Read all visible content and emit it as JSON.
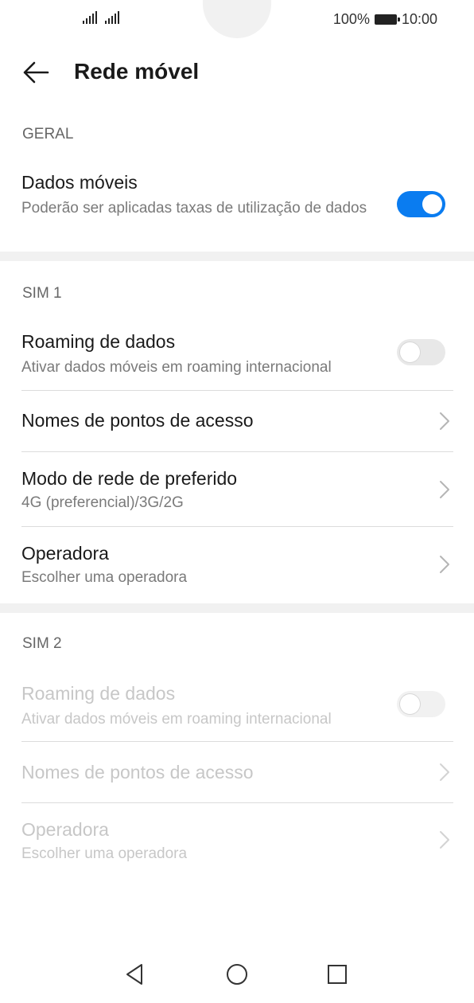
{
  "status_bar": {
    "battery_percent": "100%",
    "time": "10:00",
    "signal_icons": [
      "signal-sim1-icon",
      "signal-sim2-icon"
    ]
  },
  "header": {
    "title": "Rede móvel",
    "back_icon": "arrow-left-icon"
  },
  "general": {
    "label": "GERAL",
    "mobile_data": {
      "title": "Dados móveis",
      "subtitle": "Poderão ser aplicadas taxas de utilização de dados",
      "enabled": true
    }
  },
  "sim1": {
    "label": "SIM 1",
    "roaming": {
      "title": "Roaming de dados",
      "subtitle": "Ativar dados móveis em roaming internacional",
      "enabled": false
    },
    "apn": {
      "title": "Nomes de pontos de acesso"
    },
    "network_mode": {
      "title": "Modo de rede de preferido",
      "subtitle": "4G (preferencial)/3G/2G"
    },
    "operator": {
      "title": "Operadora",
      "subtitle": "Escolher uma operadora"
    }
  },
  "sim2": {
    "label": "SIM 2",
    "roaming": {
      "title": "Roaming de dados",
      "subtitle": "Ativar dados móveis em roaming internacional",
      "enabled": false
    },
    "apn": {
      "title": "Nomes de pontos de acesso"
    },
    "operator": {
      "title": "Operadora",
      "subtitle": "Escolher uma operadora"
    }
  },
  "nav": {
    "back": "triangle-back-icon",
    "home": "circle-home-icon",
    "recents": "square-recents-icon"
  },
  "colors": {
    "accent": "#0a7cf0",
    "background": "#f1f1f1",
    "surface": "#ffffff",
    "disabled_text": "#c7c7c7"
  }
}
